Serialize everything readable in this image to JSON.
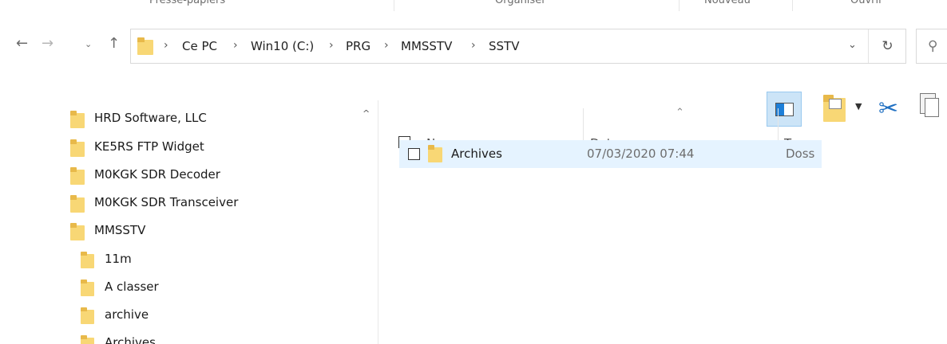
{
  "ribbon": {
    "groups": [
      "Presse-papiers",
      "Organiser",
      "Nouveau",
      "Ouvrir"
    ]
  },
  "nav": {
    "back_icon": "arrow-left-icon",
    "forward_icon": "arrow-right-icon",
    "recent_icon": "chevron-down-icon",
    "up_icon": "arrow-up-icon"
  },
  "address": {
    "breadcrumbs": [
      "Ce PC",
      "Win10 (C:)",
      "PRG",
      "MMSSTV",
      "SSTV"
    ],
    "separator": "›",
    "refresh_icon": "refresh-icon",
    "search_icon": "search-icon"
  },
  "toolbar": {
    "icons": [
      "preview-pane-icon",
      "properties-icon",
      "cut-icon",
      "copy-icon"
    ]
  },
  "tree": {
    "items": [
      {
        "label": "HRD Software, LLC",
        "level": 0
      },
      {
        "label": "KE5RS FTP Widget",
        "level": 0
      },
      {
        "label": "M0KGK SDR Decoder",
        "level": 0
      },
      {
        "label": "M0KGK SDR Transceiver",
        "level": 0
      },
      {
        "label": "MMSSTV",
        "level": 0
      },
      {
        "label": "11m",
        "level": 1
      },
      {
        "label": "A classer",
        "level": 1
      },
      {
        "label": "archive",
        "level": 1
      },
      {
        "label": "Archives",
        "level": 1
      }
    ]
  },
  "content": {
    "columns": {
      "name": "Nom",
      "date": "Date",
      "type": "Type"
    },
    "files": [
      {
        "name": "Archives",
        "date": "07/03/2020 07:44",
        "type": "Doss"
      }
    ]
  },
  "colors": {
    "folder": "#f8d775",
    "folder_tab": "#e8b94a",
    "selection": "#e5f3ff",
    "active_toggle": "#cce4f7"
  }
}
